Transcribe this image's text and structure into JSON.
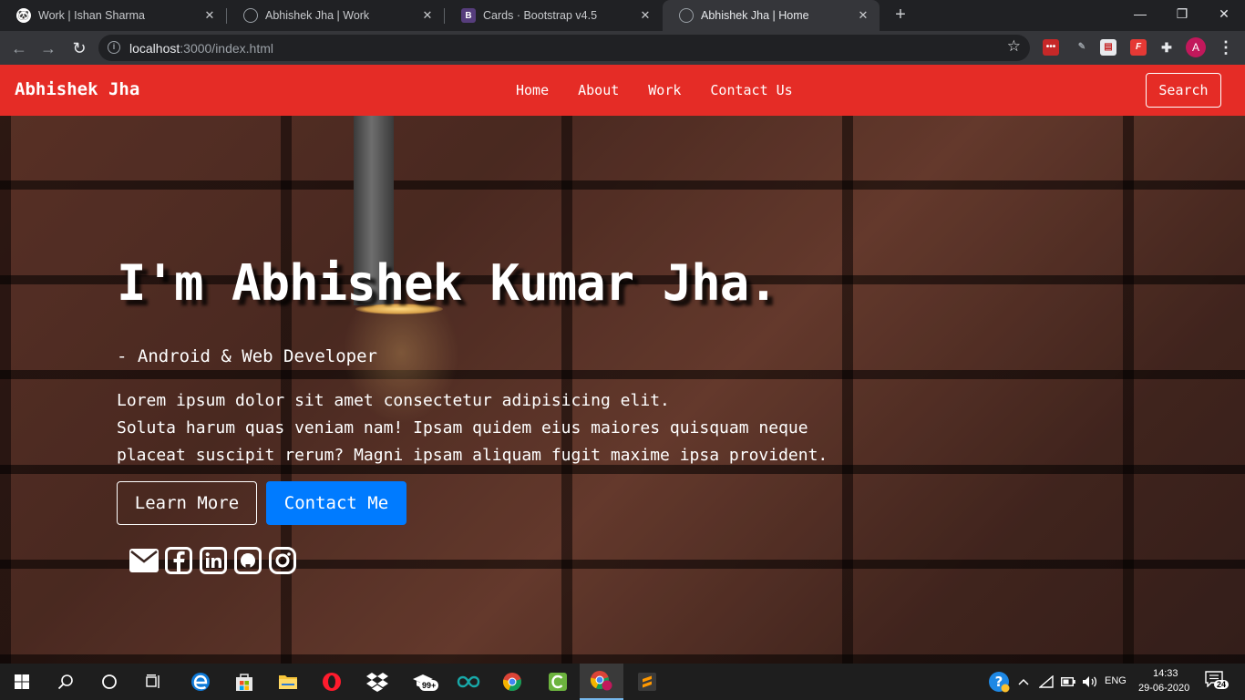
{
  "browser": {
    "tabs": [
      {
        "title": "Work | Ishan Sharma",
        "active": false
      },
      {
        "title": "Abhishek Jha | Work",
        "active": false
      },
      {
        "title": "Cards · Bootstrap v4.5",
        "active": false
      },
      {
        "title": "Abhishek Jha | Home",
        "active": true
      }
    ],
    "url_host": "localhost",
    "url_rest": ":3000/index.html"
  },
  "navbar": {
    "brand": "Abhishek Jha",
    "links": [
      "Home",
      "About",
      "Work",
      "Contact Us"
    ],
    "search_label": "Search"
  },
  "hero": {
    "heading": "I'm Abhishek Kumar Jha.",
    "role": "- Android & Web Developer",
    "description": [
      "Lorem ipsum dolor sit amet consectetur adipisicing elit.",
      "Soluta harum quas veniam nam! Ipsam quidem eius maiores quisquam neque",
      "placeat suscipit rerum? Magni ipsam aliquam fugit maxime ipsa provident."
    ],
    "learn_more_label": "Learn More",
    "contact_label": "Contact Me",
    "socials": [
      "envelope-icon",
      "facebook-icon",
      "linkedin-icon",
      "github-icon",
      "instagram-icon"
    ]
  },
  "taskbar": {
    "badge": "99+",
    "language": "ENG",
    "time": "14:33",
    "date": "29-06-2020",
    "notifications": "24"
  },
  "colors": {
    "navbar": "#e52c26",
    "primary_button": "#007bff"
  }
}
